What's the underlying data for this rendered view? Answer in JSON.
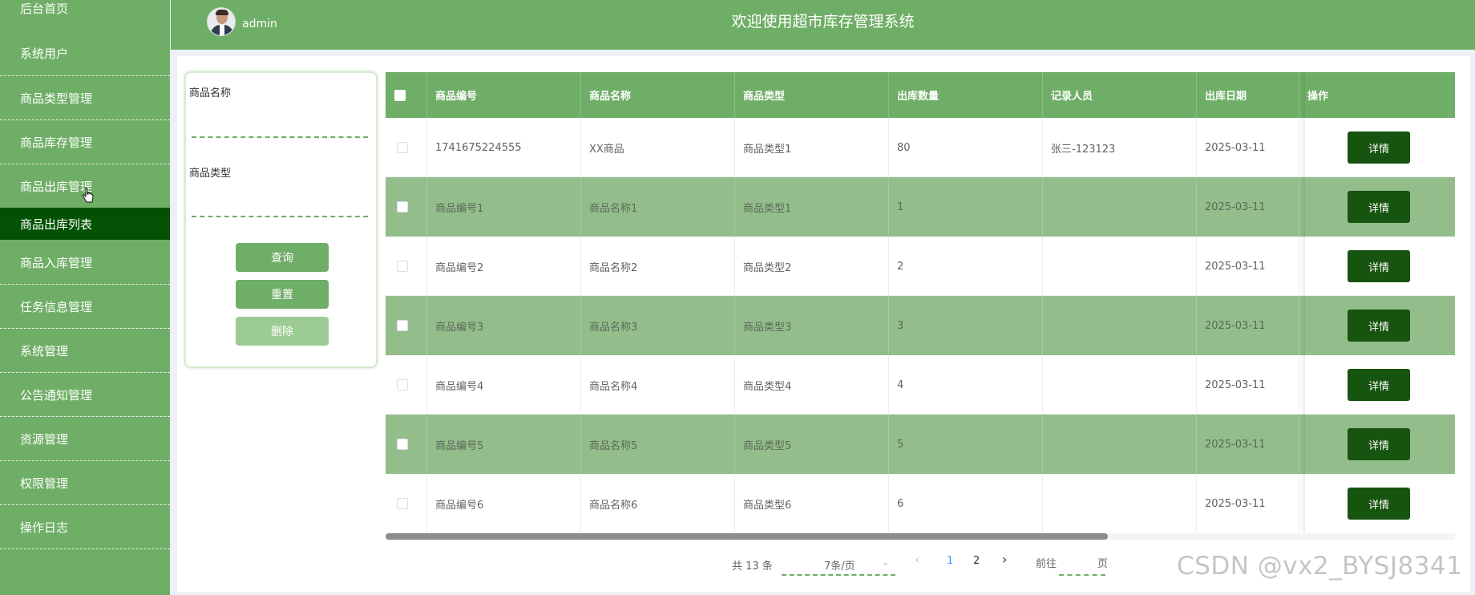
{
  "sidebar": {
    "items": [
      "后台首页",
      "系统用户",
      "商品类型管理",
      "商品库存管理",
      "商品出库管理",
      "商品出库列表",
      "商品入库管理",
      "任务信息管理",
      "系统管理",
      "公告通知管理",
      "资源管理",
      "权限管理",
      "操作日志"
    ]
  },
  "header": {
    "username": "admin",
    "title": "欢迎使用超市库存管理系统"
  },
  "search": {
    "name_label": "商品名称",
    "type_label": "商品类型",
    "query_btn": "查询",
    "reset_btn": "重置",
    "delete_btn": "删除"
  },
  "table": {
    "columns": [
      "商品编号",
      "商品名称",
      "商品类型",
      "出库数量",
      "记录人员",
      "出库日期",
      "操作"
    ],
    "rows": [
      {
        "id": "1741675224555",
        "name": "XX商品",
        "type": "商品类型1",
        "qty": "80",
        "recorder": "张三-123123",
        "date": "2025-03-11",
        "action": "详情"
      },
      {
        "id": "商品编号1",
        "name": "商品名称1",
        "type": "商品类型1",
        "qty": "1",
        "recorder": "",
        "date": "2025-03-11",
        "action": "详情"
      },
      {
        "id": "商品编号2",
        "name": "商品名称2",
        "type": "商品类型2",
        "qty": "2",
        "recorder": "",
        "date": "2025-03-11",
        "action": "详情"
      },
      {
        "id": "商品编号3",
        "name": "商品名称3",
        "type": "商品类型3",
        "qty": "3",
        "recorder": "",
        "date": "2025-03-11",
        "action": "详情"
      },
      {
        "id": "商品编号4",
        "name": "商品名称4",
        "type": "商品类型4",
        "qty": "4",
        "recorder": "",
        "date": "2025-03-11",
        "action": "详情"
      },
      {
        "id": "商品编号5",
        "name": "商品名称5",
        "type": "商品类型5",
        "qty": "5",
        "recorder": "",
        "date": "2025-03-11",
        "action": "详情"
      },
      {
        "id": "商品编号6",
        "name": "商品名称6",
        "type": "商品类型6",
        "qty": "6",
        "recorder": "",
        "date": "2025-03-11",
        "action": "详情"
      }
    ]
  },
  "pagination": {
    "total": "共 13 条",
    "page_size": "7条/页",
    "prev": "‹",
    "pages": [
      "1",
      "2"
    ],
    "next": "›",
    "goto_prefix": "前往",
    "goto_suffix": "页"
  },
  "watermark": "CSDN @vx2_BYSJ8341",
  "colors": {
    "primary": "#6fae66",
    "active": "#035203",
    "detail_btn": "#17540f",
    "alt_row": "#93bd8b"
  }
}
